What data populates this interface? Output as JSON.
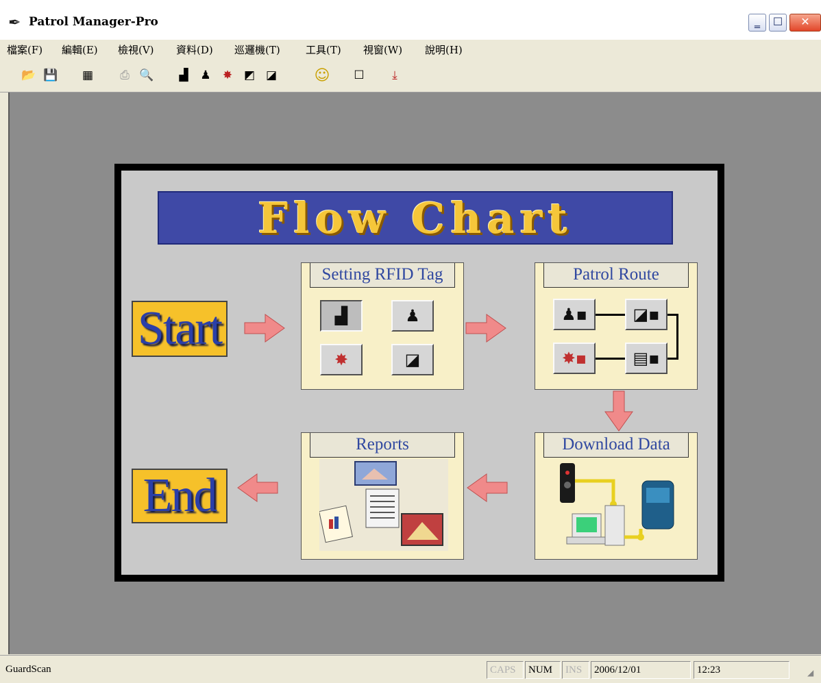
{
  "window": {
    "title": "Patrol Manager-Pro",
    "app_icon": "quill-pen-icon",
    "controls": {
      "minimize": "minimize-icon",
      "maximize": "maximize-icon",
      "close": "close-icon"
    }
  },
  "menu": [
    {
      "label": "檔案(F)"
    },
    {
      "label": "編輯(E)"
    },
    {
      "label": "檢視(V)"
    },
    {
      "label": "資料(D)"
    },
    {
      "label": "巡邏機(T)"
    },
    {
      "label": "工具(T)"
    },
    {
      "label": "視窗(W)"
    },
    {
      "label": "說明(H)"
    }
  ],
  "toolbar": [
    {
      "icon": "open-folder-icon",
      "glyph": "📂",
      "enabled": true
    },
    {
      "icon": "save-icon",
      "glyph": "💾",
      "enabled": false
    },
    {
      "icon": "table-icon",
      "glyph": "▦",
      "enabled": true
    },
    {
      "icon": "print-icon",
      "glyph": "⎙",
      "enabled": false
    },
    {
      "icon": "print-preview-icon",
      "glyph": "🔍",
      "enabled": false
    },
    {
      "icon": "checkpoint-icon",
      "glyph": "▟",
      "enabled": true
    },
    {
      "icon": "guard-icon",
      "glyph": "♟",
      "enabled": true
    },
    {
      "icon": "event-icon",
      "glyph": "✸",
      "enabled": true
    },
    {
      "icon": "checkpoint-event-icon",
      "glyph": "◩",
      "enabled": true
    },
    {
      "icon": "route-icon",
      "glyph": "◪",
      "enabled": true
    },
    {
      "icon": "smiley-icon",
      "glyph": "☺",
      "enabled": true
    },
    {
      "icon": "new-document-icon",
      "glyph": "☐",
      "enabled": true
    },
    {
      "icon": "download-icon",
      "glyph": "⤓",
      "enabled": true
    }
  ],
  "flowchart": {
    "title": "Flow Chart",
    "start_label": "Start",
    "end_label": "End",
    "setting": {
      "label": "Setting RFID Tag",
      "buttons": [
        "checkpoint-icon",
        "guard-icon",
        "event-icon",
        "route-icon"
      ]
    },
    "patrol_route": {
      "label": "Patrol Route",
      "nodes": [
        "guard-reader-icon",
        "checkpoint-reader-icon",
        "event-reader-icon",
        "report-reader-icon"
      ]
    },
    "download": {
      "label": "Download Data",
      "illustration": "download-devices-illustration"
    },
    "reports": {
      "label": "Reports",
      "illustration": "reports-documents-illustration"
    },
    "arrow_color": "#f08080"
  },
  "status": {
    "app_name": "GuardScan",
    "caps": "CAPS",
    "num": "NUM",
    "ins": "INS",
    "date": "2006/12/01",
    "time": "12:23"
  }
}
